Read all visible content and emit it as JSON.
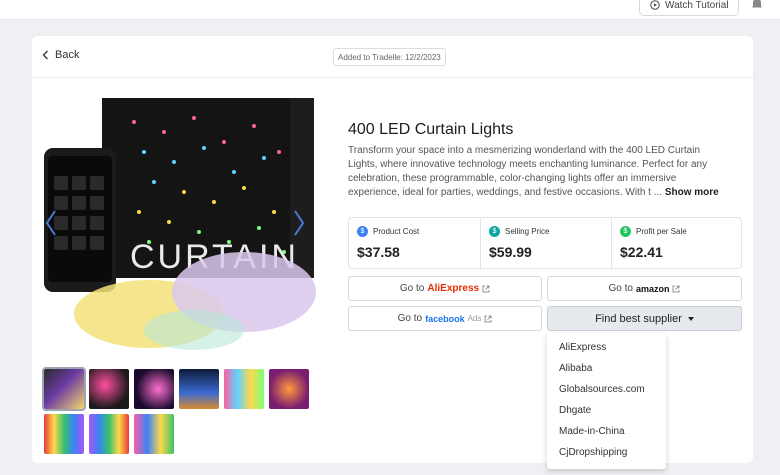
{
  "topbar": {
    "tutorial_label": "Watch Tutorial"
  },
  "header": {
    "back_label": "Back",
    "added_label": "Added to Tradelle: 12/2/2023"
  },
  "product": {
    "title": "400 LED Curtain Lights",
    "description": "Transform your space into a mesmerizing wonderland with the 400 LED Curtain Lights, where innovative technology meets enchanting luminance. Perfect for any celebration, these programmable, color-changing lights offer an immersive experience, ideal for parties, weddings, and festive occasions. With t ...",
    "show_more": "Show more",
    "image_text": "CURTAIN"
  },
  "stats": [
    {
      "label": "Product Cost",
      "value": "$37.58",
      "icon": "tag-icon",
      "color": "#3b82f6"
    },
    {
      "label": "Selling Price",
      "value": "$59.99",
      "icon": "price-icon",
      "color": "#0ea5a4"
    },
    {
      "label": "Profit per Sale",
      "value": "$22.41",
      "icon": "profit-icon",
      "color": "#22c55e"
    }
  ],
  "buttons": {
    "go_to": "Go to",
    "aliexpress": "AliExpress",
    "amazon": "amazon",
    "facebook": "facebook",
    "ads": "Ads",
    "find_supplier": "Find best supplier"
  },
  "supplier_options": [
    "AliExpress",
    "Alibaba",
    "Globalsources.com",
    "Dhgate",
    "Made-in-China",
    "CjDropshipping"
  ],
  "colors": {
    "accent": "#3b82f6",
    "profit": "#22c55e",
    "aliexpress": "#e62e04",
    "facebook": "#1877f2"
  }
}
